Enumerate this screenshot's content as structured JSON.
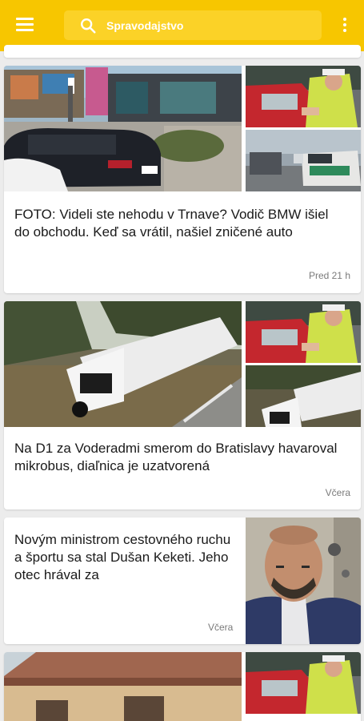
{
  "app_bar": {
    "background": "#f7c600",
    "menu_icon": "hamburger-menu-icon",
    "search_icon": "search-icon",
    "search_placeholder": "Spravodajstvo",
    "overflow_icon": "kebab-menu-icon"
  },
  "articles": [
    {
      "title": "FOTO: Videli ste nehodu v Trnave? Vodič BMW išiel do obchodu. Keď sa vrátil, našiel zničené auto",
      "time": "Pred 21 h"
    },
    {
      "title": "Na D1 za Voderadmi smerom do Bratislavy havaroval mikrobus, diaľnica je uzatvorená",
      "time": "Včera"
    },
    {
      "title": "Novým ministrom cestovného ruchu a športu sa stal Dušan Keketi. Jeho otec hrával za",
      "time": "Včera"
    }
  ]
}
